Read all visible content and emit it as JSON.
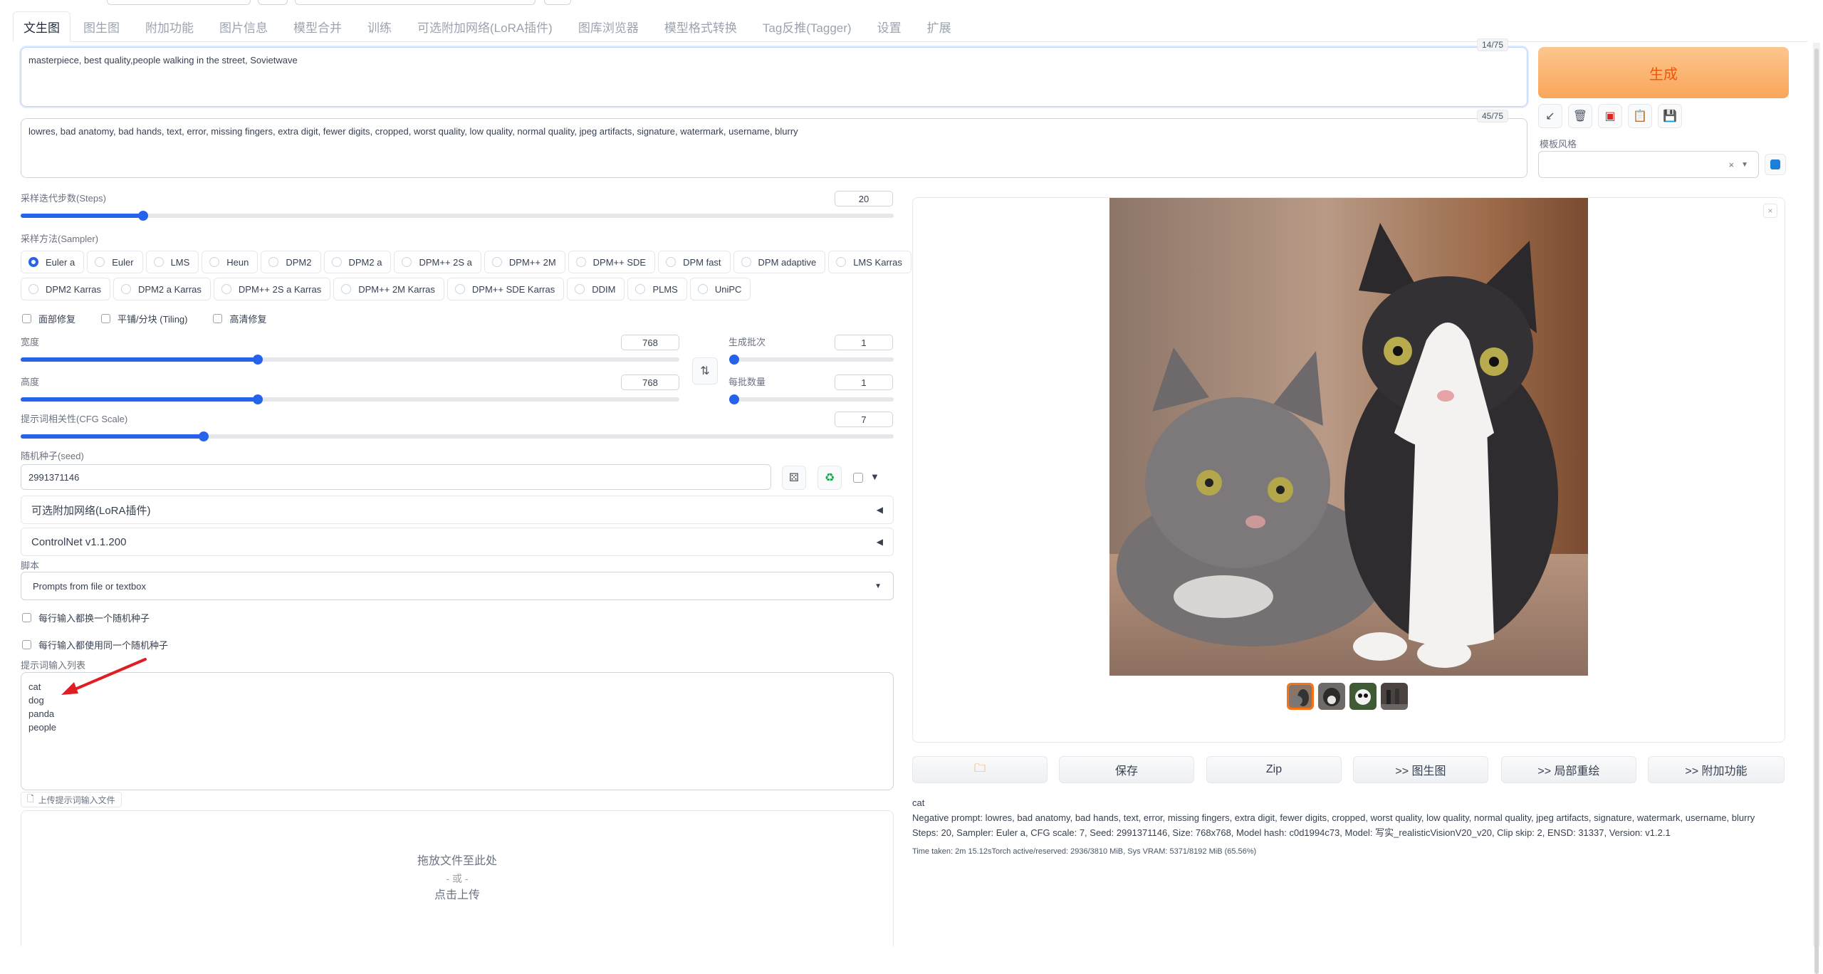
{
  "tabs": [
    "文生图",
    "图生图",
    "附加功能",
    "图片信息",
    "模型合并",
    "训练",
    "可选附加网络(LoRA插件)",
    "图库浏览器",
    "模型格式转换",
    "Tag反推(Tagger)",
    "设置",
    "扩展"
  ],
  "prompt": {
    "value": "masterpiece, best quality,people walking in the street, Sovietwave",
    "counter": "14/75"
  },
  "negative_prompt": {
    "value": "lowres, bad anatomy, bad hands, text, error, missing fingers, extra digit, fewer digits, cropped, worst quality, low quality, normal quality, jpeg artifacts, signature, watermark, username, blurry",
    "counter": "45/75"
  },
  "generate_label": "生成",
  "style_label": "模板风格",
  "steps": {
    "label": "采样迭代步数(Steps)",
    "value": "20",
    "fraction": 0.14
  },
  "sampler": {
    "label": "采样方法(Sampler)",
    "row1": [
      "Euler a",
      "Euler",
      "LMS",
      "Heun",
      "DPM2",
      "DPM2 a",
      "DPM++ 2S a",
      "DPM++ 2M",
      "DPM++ SDE",
      "DPM fast",
      "DPM adaptive",
      "LMS Karras"
    ],
    "row2": [
      "DPM2 Karras",
      "DPM2 a Karras",
      "DPM++ 2S a Karras",
      "DPM++ 2M Karras",
      "DPM++ SDE Karras",
      "DDIM",
      "PLMS",
      "UniPC"
    ]
  },
  "options": {
    "restore_faces": "面部修复",
    "tiling": "平铺/分块 (Tiling)",
    "hires_fix": "高清修复"
  },
  "width": {
    "label": "宽度",
    "value": "768",
    "fraction": 0.36
  },
  "height": {
    "label": "高度",
    "value": "768",
    "fraction": 0.36
  },
  "batch_count": {
    "label": "生成批次",
    "value": "1",
    "fraction": 0.0
  },
  "batch_size": {
    "label": "每批数量",
    "value": "1",
    "fraction": 0.0
  },
  "cfg": {
    "label": "提示词相关性(CFG Scale)",
    "value": "7",
    "fraction": 0.21
  },
  "seed": {
    "label": "随机种子(seed)",
    "value": "2991371146"
  },
  "accordions": {
    "lora": "可选附加网络(LoRA插件)",
    "controlnet": "ControlNet v1.1.200"
  },
  "script": {
    "label": "脚本",
    "value": "Prompts from file or textbox"
  },
  "script_options": {
    "iterate_seed": "每行输入都换一个随机种子",
    "same_seed": "每行输入都使用同一个随机种子"
  },
  "prompt_list": {
    "label": "提示词输入列表",
    "lines": "cat\ndog\npanda\npeople"
  },
  "upload": {
    "button": "上传提示词输入文件",
    "drop": "拖放文件至此处",
    "or": "- 或 -",
    "click": "点击上传"
  },
  "actions": {
    "save": "保存",
    "zip": "Zip",
    "to_img2img": ">> 图生图",
    "to_inpaint": ">> 局部重绘",
    "to_extras": ">> 附加功能"
  },
  "generation_info": {
    "prompt": "cat",
    "negative": "Negative prompt: lowres, bad anatomy, bad hands, text, error, missing fingers, extra digit, fewer digits, cropped, worst quality, low quality, normal quality, jpeg artifacts, signature, watermark, username, blurry",
    "params": "Steps: 20, Sampler: Euler a, CFG scale: 7, Seed: 2991371146, Size: 768x768, Model hash: c0d1994c73, Model: 写实_realisticVisionV20_v20, Clip skip: 2, ENSD: 31337, Version: v1.2.1",
    "time": "Time taken: 2m 15.12sTorch active/reserved: 2936/3810 MiB, Sys VRAM: 5371/8192 MiB (65.56%)"
  }
}
